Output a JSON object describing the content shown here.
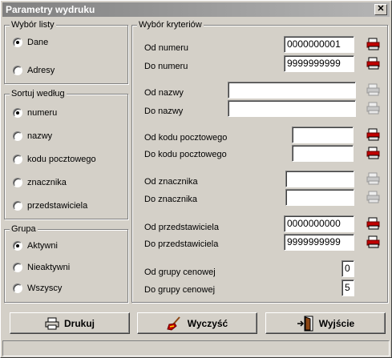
{
  "window": {
    "title": "Parametry wydruku",
    "close": "✕"
  },
  "groups": {
    "wybor_listy": {
      "legend": "Wybór listy",
      "options": [
        "Dane",
        "Adresy"
      ],
      "selected": 0
    },
    "sortuj": {
      "legend": "Sortuj według",
      "options": [
        "numeru",
        "nazwy",
        "kodu pocztowego",
        "znacznika",
        "przedstawiciela"
      ],
      "selected": 0
    },
    "grupa": {
      "legend": "Grupa",
      "options": [
        "Aktywni",
        "Nieaktywni",
        "Wszyscy"
      ],
      "selected": 0
    },
    "kryteria": {
      "legend": "Wybór kryteriów"
    }
  },
  "fields": {
    "od_numeru": {
      "label": "Od numeru",
      "value": "0000000001"
    },
    "do_numeru": {
      "label": "Do numeru",
      "value": "9999999999"
    },
    "od_nazwy": {
      "label": "Od nazwy",
      "value": ""
    },
    "do_nazwy": {
      "label": "Do nazwy",
      "value": ""
    },
    "od_kodu": {
      "label": "Od kodu pocztowego",
      "value": ""
    },
    "do_kodu": {
      "label": "Do kodu pocztowego",
      "value": ""
    },
    "od_znacznika": {
      "label": "Od znacznika",
      "value": ""
    },
    "do_znacznika": {
      "label": "Do znacznika",
      "value": ""
    },
    "od_przedst": {
      "label": "Od przedstawiciela",
      "value": "0000000000"
    },
    "do_przedst": {
      "label": "Do przedstawiciela",
      "value": "9999999999"
    },
    "od_grupy": {
      "label": "Od grupy cenowej",
      "value": "0"
    },
    "do_grupy": {
      "label": "Do grupy cenowej",
      "value": "5"
    }
  },
  "buttons": {
    "print": "Drukuj",
    "clear": "Wyczyść",
    "exit": "Wyjście"
  },
  "colors": {
    "title_start": "#808080",
    "picker_active": "#c00000",
    "picker_disabled": "#a0a0a0"
  }
}
